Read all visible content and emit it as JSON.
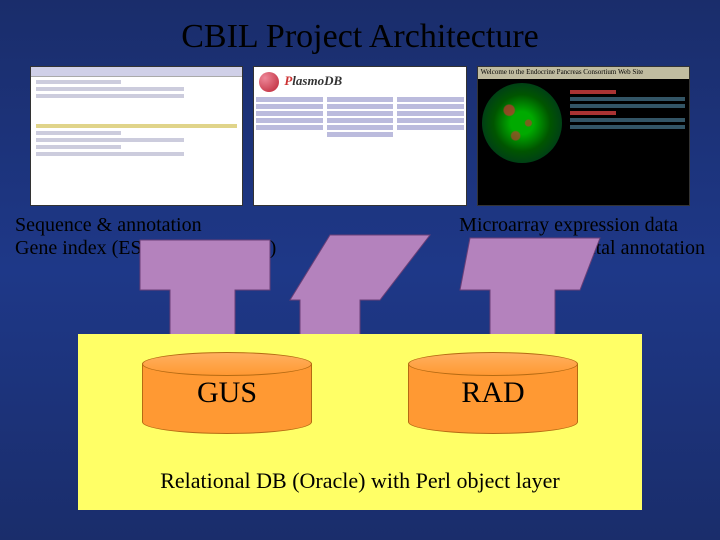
{
  "title": "CBIL Project Architecture",
  "screenshots": {
    "middle_brand": "PlasmoDB",
    "right_topbar": "Welcome to the Endocrine Pancreas Consortium Web Site"
  },
  "left_caption_line1": "Sequence & annotation",
  "left_caption_line2": "Gene index (ESTs and m.RNAs)",
  "right_caption_line1": "Microarray expression data",
  "right_caption_line2": "experimental annotation",
  "db": {
    "left_cylinder": "GUS",
    "right_cylinder": "RAD",
    "caption": "Relational DB (Oracle) with Perl object layer"
  },
  "colors": {
    "background_gradient_top": "#1a2d6b",
    "background_gradient_mid": "#1e3888",
    "db_box": "#ffff66",
    "cylinder": "#ff9933",
    "arrow": "#b482bd"
  }
}
